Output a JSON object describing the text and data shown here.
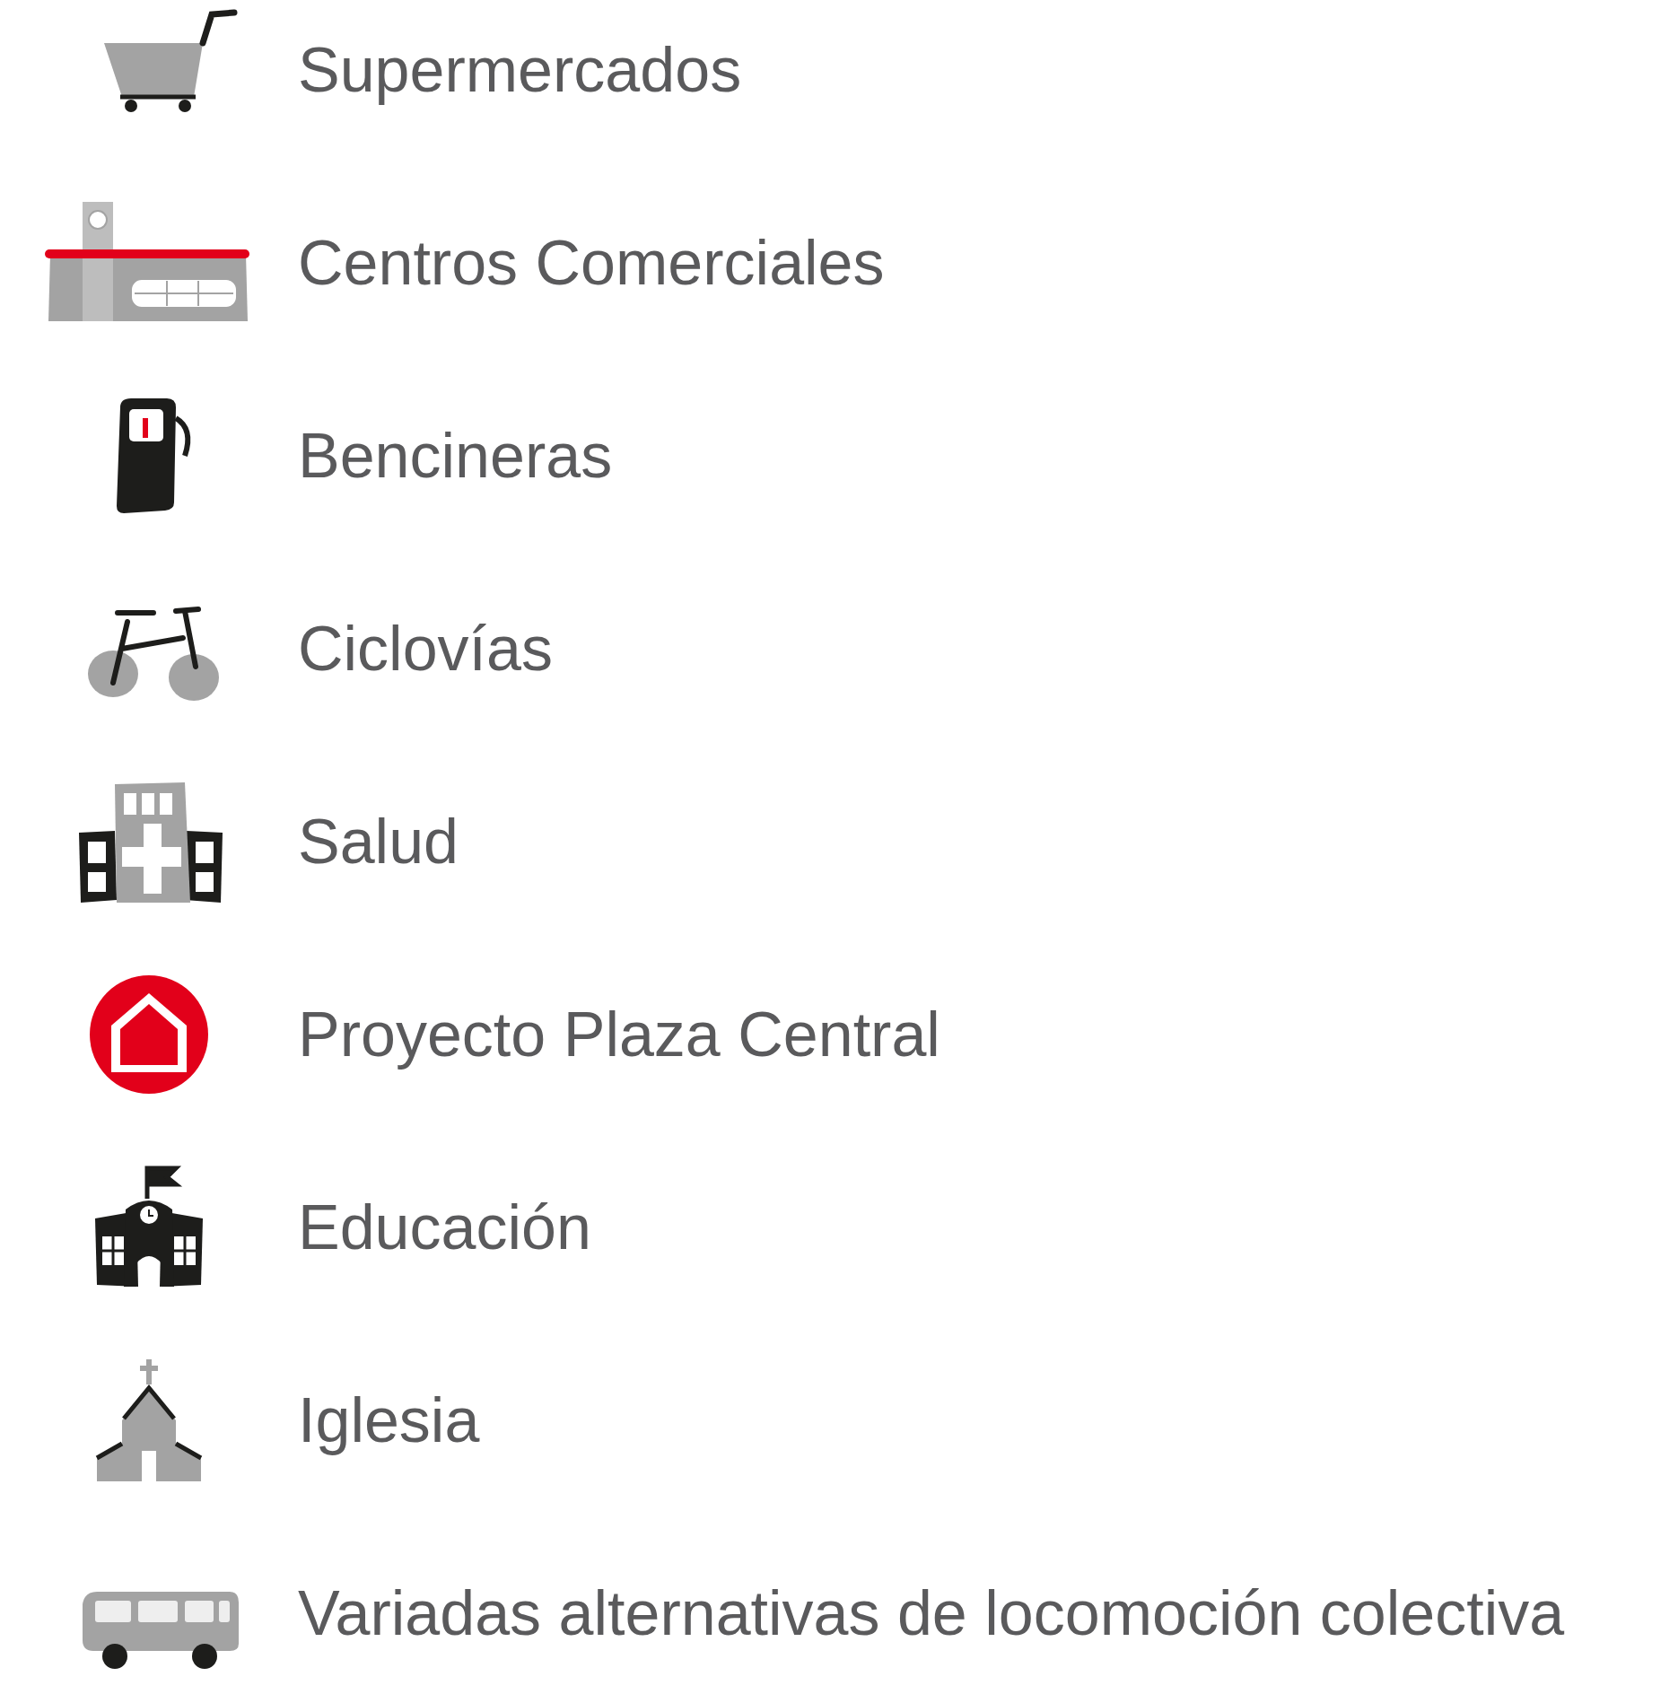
{
  "legend": [
    {
      "kind": "cart",
      "label": "Supermercados"
    },
    {
      "kind": "mall",
      "label": "Centros Comerciales"
    },
    {
      "kind": "fuel",
      "label": "Bencineras"
    },
    {
      "kind": "bike",
      "label": "Ciclovías"
    },
    {
      "kind": "hospital",
      "label": "Salud"
    },
    {
      "kind": "home",
      "label": "Proyecto Plaza Central"
    },
    {
      "kind": "school",
      "label": "Educación"
    },
    {
      "kind": "church",
      "label": "Iglesia"
    },
    {
      "kind": "bus",
      "label": "Variadas alternativas de locomoción colectiva"
    }
  ]
}
